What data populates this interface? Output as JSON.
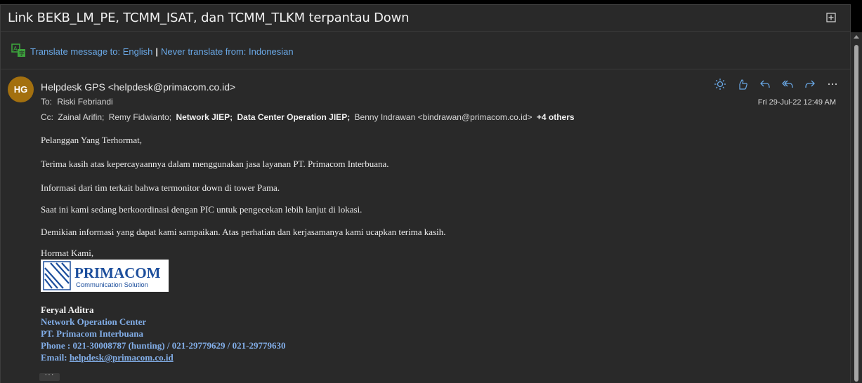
{
  "subject": "Link BEKB_LM_PE, TCMM_ISAT, dan TCMM_TLKM terpantau Down",
  "translate": {
    "to_label": "Translate message to: English",
    "separator": "|",
    "never_label": "Never translate from: Indonesian"
  },
  "message": {
    "avatar_initials": "HG",
    "sender": "Helpdesk GPS <helpdesk@primacom.co.id>",
    "to_label": "To:",
    "to": "Riski Febriandi",
    "cc_label": "Cc:",
    "cc": [
      {
        "name": "Zainal Arifin;",
        "bold": false
      },
      {
        "name": "Remy Fidwianto;",
        "bold": false
      },
      {
        "name": "Network JIEP;",
        "bold": true
      },
      {
        "name": "Data Center Operation JIEP;",
        "bold": true
      },
      {
        "name": "Benny Indrawan <bindrawan@primacom.co.id>",
        "bold": false
      }
    ],
    "cc_more": "+4 others",
    "date": "Fri 29-Jul-22 12:49 AM"
  },
  "actions": [
    "brightness-icon",
    "like-icon",
    "reply-icon",
    "reply-all-icon",
    "forward-icon",
    "more-icon"
  ],
  "body": {
    "greeting": "Pelanggan Yang Terhormat,",
    "p1": "Terima kasih atas kepercayaannya dalam menggunakan jasa layanan PT. Primacom Interbuana.",
    "p2": "Informasi dari tim terkait bahwa termonitor down di tower Pama.",
    "p3": "Saat ini kami sedang berkoordinasi dengan PIC untuk pengecekan lebih lanjut di lokasi.",
    "p4": "Demikian informasi yang dapat kami sampaikan. Atas perhatian dan kerjasamanya kami ucapkan terima kasih.",
    "closing": "Hormat Kami,"
  },
  "logo": {
    "name": "PRIMACOM",
    "tagline": "Communication Solution"
  },
  "signature": {
    "name": "Feryal Aditra",
    "dept": "Network Operation Center",
    "company": "PT. Primacom Interbuana",
    "phone": "Phone : 021-30008787 (hunting) / 021-29779629 / 021-29779630",
    "email_label": "Email:",
    "email": "helpdesk@primacom.co.id"
  },
  "more_button": "···",
  "colors": {
    "background": "#292929",
    "link": "#6aa8e6",
    "signature_blue": "#82aee8",
    "avatar": "#a3700f",
    "action_icon": "#6aa8e6"
  }
}
